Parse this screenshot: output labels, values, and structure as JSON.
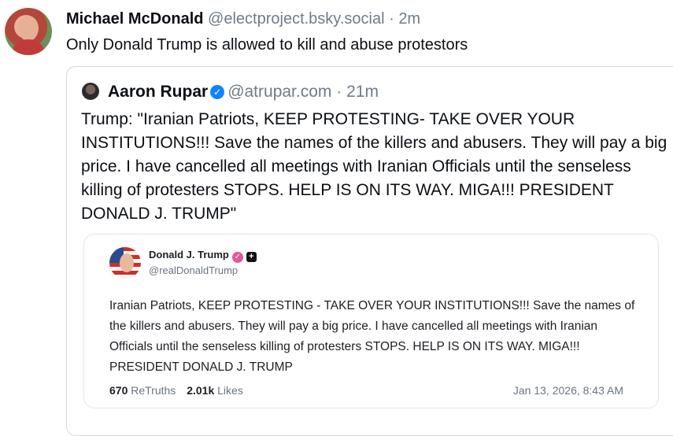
{
  "post": {
    "author_name": "Michael McDonald",
    "author_handle": "@electproject.bsky.social",
    "separator": "·",
    "time": "2m",
    "text": "Only Donald Trump is allowed to kill and abuse protestors"
  },
  "quote": {
    "author_name": "Aaron Rupar",
    "verified_icon": "verified-check-icon",
    "author_handle": "@atrupar.com",
    "separator": "·",
    "time": "21m",
    "text": "Trump: \"Iranian Patriots, KEEP PROTESTING- TAKE OVER YOUR INSTITUTIONS!!! Save the names of the killers and abusers. They will pay a big price. I have cancelled all meetings with Iranian Officials until the senseless killing of protesters STOPS. HELP IS ON ITS WAY. MIGA!!! PRESIDENT DONALD J. TRUMP\""
  },
  "truth": {
    "author_name": "Donald J. Trump",
    "author_handle": "@realDonaldTrump",
    "text": "Iranian Patriots, KEEP PROTESTING - TAKE OVER YOUR INSTITUTIONS!!! Save the names of the killers and abusers. They will pay a big price. I have cancelled all meetings with Iranian Officials until the senseless killing of protesters STOPS. HELP IS ON ITS WAY. MIGA!!! PRESIDENT DONALD J. TRUMP",
    "retruths_count": "670",
    "retruths_label": "ReTruths",
    "likes_count": "2.01k",
    "likes_label": "Likes",
    "date": "Jan 13, 2026, 8:43 AM"
  },
  "colors": {
    "verified_blue": "#1083fe",
    "truth_badge_pink": "#e2559a",
    "muted_text": "#6f7c8a"
  }
}
